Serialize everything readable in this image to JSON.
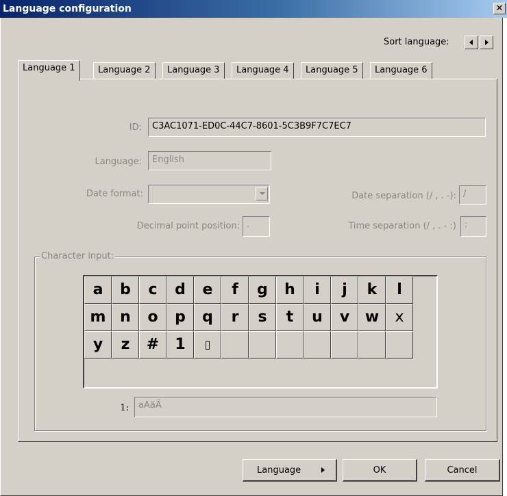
{
  "window": {
    "title": "Language configuration",
    "close_glyph": "✕"
  },
  "sort": {
    "label": "Sort language:"
  },
  "tabs": [
    {
      "label": "Language 1",
      "active": true
    },
    {
      "label": "Language 2"
    },
    {
      "label": "Language 3"
    },
    {
      "label": "Language 4"
    },
    {
      "label": "Language 5"
    },
    {
      "label": "Language 6"
    }
  ],
  "form": {
    "id_label": "ID:",
    "id_value": "C3AC1071-ED0C-44C7-8601-5C3B9F7C7EC7",
    "language_label": "Language:",
    "language_value": "English",
    "date_format_label": "Date format:",
    "date_format_value": "",
    "date_sep_label": "Date separation (/ , . -):",
    "date_sep_value": "/",
    "decimal_label": "Decimal point position:",
    "decimal_value": ".",
    "time_sep_label": "Time separation (/ , . - :)",
    "time_sep_value": ":"
  },
  "character_input": {
    "legend": "Character input:",
    "rows": [
      [
        "a",
        "b",
        "c",
        "d",
        "e",
        "f",
        "g",
        "h",
        "i",
        "j",
        "k",
        "l"
      ],
      [
        "m",
        "n",
        "o",
        "p",
        "q",
        "r",
        "s",
        "t",
        "u",
        "v",
        "w",
        "x"
      ],
      [
        "y",
        "z",
        "#",
        "1",
        "▯",
        "",
        "",
        "",
        "",
        "",
        "",
        ""
      ]
    ],
    "field_label": "1:",
    "field_value": "aAäÄ"
  },
  "buttons": {
    "language": "Language",
    "ok": "OK",
    "cancel": "Cancel"
  }
}
